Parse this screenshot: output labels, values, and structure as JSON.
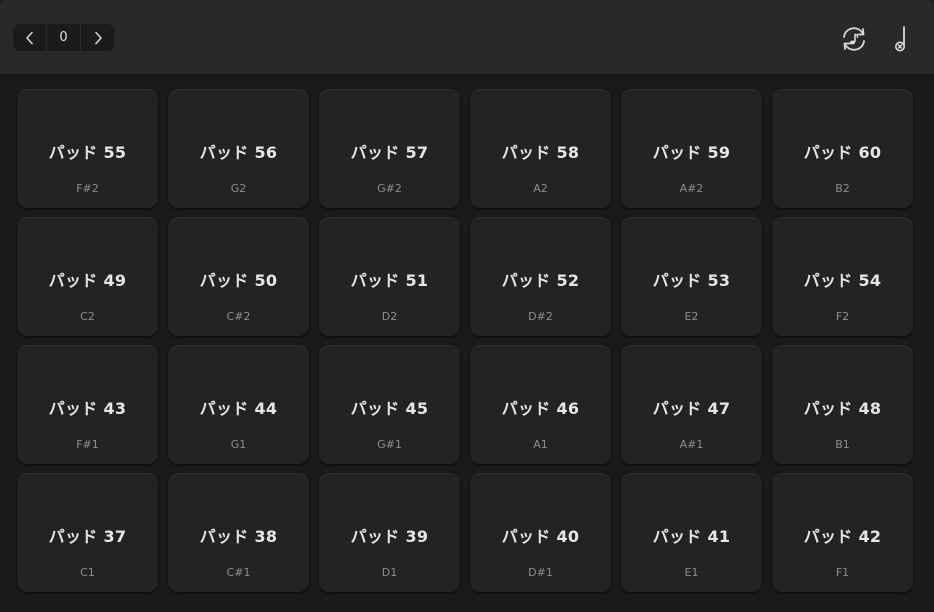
{
  "toolbar": {
    "bank_value": "0",
    "prev_icon": "chevron-left-icon",
    "next_icon": "chevron-right-icon",
    "cycle_icon": "cycle-note-icon",
    "note_icon": "note-off-icon"
  },
  "colors": {
    "background": "#1a1a1c",
    "toolbar": "#29292b",
    "pad": "#232326",
    "pad_text": "#e6e6e8",
    "note_text": "#8e8e92"
  },
  "pads": [
    {
      "name": "パッド 55",
      "note": "F#2"
    },
    {
      "name": "パッド 56",
      "note": "G2"
    },
    {
      "name": "パッド 57",
      "note": "G#2"
    },
    {
      "name": "パッド 58",
      "note": "A2"
    },
    {
      "name": "パッド 59",
      "note": "A#2"
    },
    {
      "name": "パッド 60",
      "note": "B2"
    },
    {
      "name": "パッド 49",
      "note": "C2"
    },
    {
      "name": "パッド 50",
      "note": "C#2"
    },
    {
      "name": "パッド 51",
      "note": "D2"
    },
    {
      "name": "パッド 52",
      "note": "D#2"
    },
    {
      "name": "パッド 53",
      "note": "E2"
    },
    {
      "name": "パッド 54",
      "note": "F2"
    },
    {
      "name": "パッド 43",
      "note": "F#1"
    },
    {
      "name": "パッド 44",
      "note": "G1"
    },
    {
      "name": "パッド 45",
      "note": "G#1"
    },
    {
      "name": "パッド 46",
      "note": "A1"
    },
    {
      "name": "パッド 47",
      "note": "A#1"
    },
    {
      "name": "パッド 48",
      "note": "B1"
    },
    {
      "name": "パッド 37",
      "note": "C1"
    },
    {
      "name": "パッド 38",
      "note": "C#1"
    },
    {
      "name": "パッド 39",
      "note": "D1"
    },
    {
      "name": "パッド 40",
      "note": "D#1"
    },
    {
      "name": "パッド 41",
      "note": "E1"
    },
    {
      "name": "パッド 42",
      "note": "F1"
    }
  ]
}
